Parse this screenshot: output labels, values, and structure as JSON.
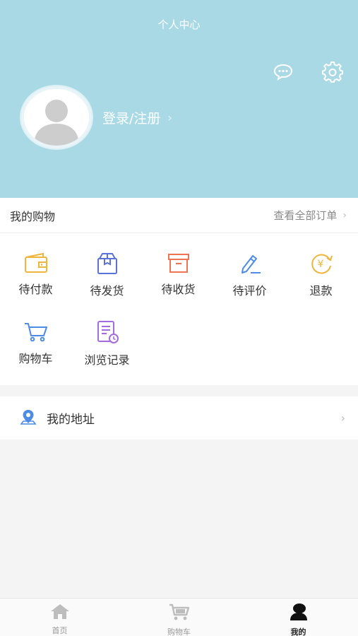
{
  "header": {
    "title": "个人中心",
    "login_label": "登录/注册",
    "background": "#a9d9e5"
  },
  "icons": {
    "message": "message-dots-icon",
    "settings": "gear-icon",
    "avatar": "default-avatar"
  },
  "shopping": {
    "title": "我的购物",
    "view_all": "查看全部订单",
    "items": [
      {
        "label": "待付款",
        "icon": "wallet-icon",
        "color": "#f0b53c"
      },
      {
        "label": "待发货",
        "icon": "package-icon",
        "color": "#5b72d8"
      },
      {
        "label": "待收货",
        "icon": "box-icon",
        "color": "#ef7453"
      },
      {
        "label": "待评价",
        "icon": "pen-icon",
        "color": "#4c8be6"
      },
      {
        "label": "退款",
        "icon": "refund-yen-icon",
        "color": "#f0b53c"
      },
      {
        "label": "购物车",
        "icon": "cart-icon",
        "color": "#4c8be6"
      },
      {
        "label": "浏览记录",
        "icon": "history-icon",
        "color": "#a56be0"
      }
    ]
  },
  "address": {
    "label": "我的地址",
    "icon": "location-pin-icon",
    "color": "#4c8be6"
  },
  "tabbar": {
    "items": [
      {
        "label": "首页",
        "icon": "home-icon"
      },
      {
        "label": "购物车",
        "icon": "cart-icon"
      },
      {
        "label": "我的",
        "icon": "user-icon",
        "active": true
      }
    ]
  }
}
